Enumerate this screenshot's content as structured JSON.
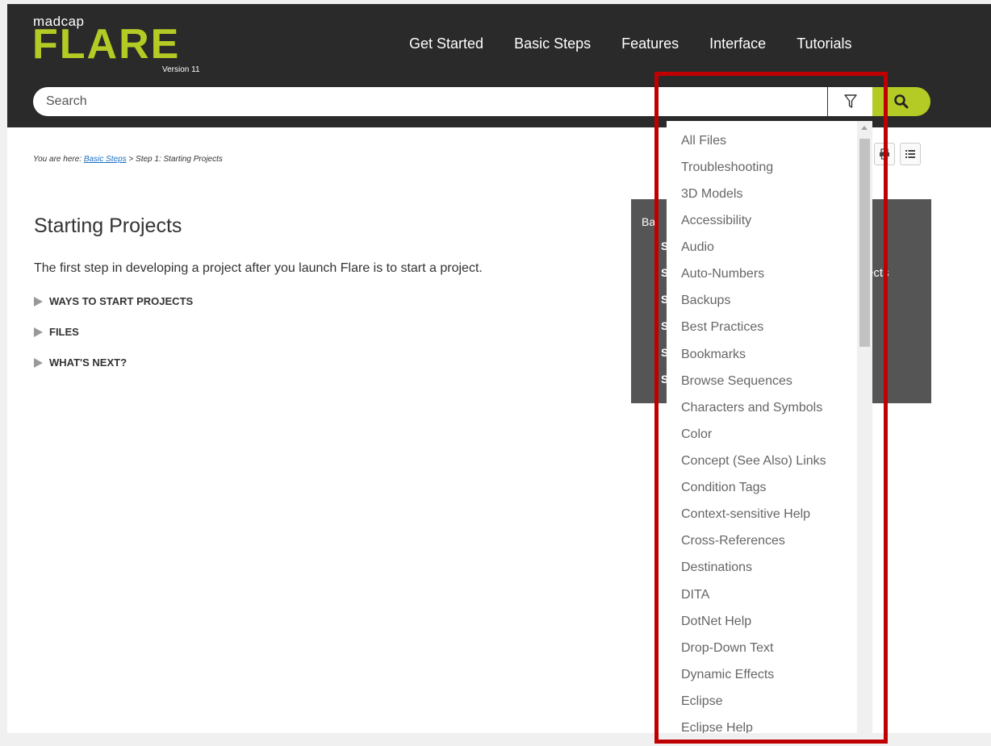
{
  "logo": {
    "brand_small": "madcap",
    "brand_big": "FLARE",
    "version": "Version 11"
  },
  "nav": {
    "items": [
      "Get Started",
      "Basic Steps",
      "Features",
      "Interface",
      "Tutorials"
    ]
  },
  "search": {
    "placeholder": "Search"
  },
  "icons": [
    "filter-icon",
    "search-icon",
    "print-icon",
    "toc-list-icon"
  ],
  "breadcrumb": {
    "prefix": "You are here: ",
    "link": "Basic Steps",
    "separator": " > ",
    "current": "Step 1: Starting Projects"
  },
  "main": {
    "title": "Starting Projects",
    "intro": "The first step in developing a project after you launch Flare is to start a project.",
    "toggles": [
      "WAYS TO START PROJECTS",
      "FILES",
      "WHAT'S NEXT?"
    ]
  },
  "side_panel": {
    "title_fragment": "Ba",
    "letters": [
      "S",
      "S",
      "S",
      "S",
      "S",
      "S"
    ],
    "trail_fragment": "ects"
  },
  "filter_dropdown": {
    "items": [
      "All Files",
      "Troubleshooting",
      "3D Models",
      "Accessibility",
      "Audio",
      "Auto-Numbers",
      "Backups",
      "Best Practices",
      "Bookmarks",
      "Browse Sequences",
      "Characters and Symbols",
      "Color",
      "Concept (See Also) Links",
      "Condition Tags",
      "Context-sensitive Help",
      "Cross-References",
      "Destinations",
      "DITA",
      "DotNet Help",
      "Drop-Down Text",
      "Dynamic Effects",
      "Eclipse",
      "Eclipse Help"
    ]
  },
  "colors": {
    "header_bg": "#2a2a2a",
    "accent_green": "#b5cb25",
    "panel_gray": "#555555",
    "highlight_red": "#c00000"
  }
}
